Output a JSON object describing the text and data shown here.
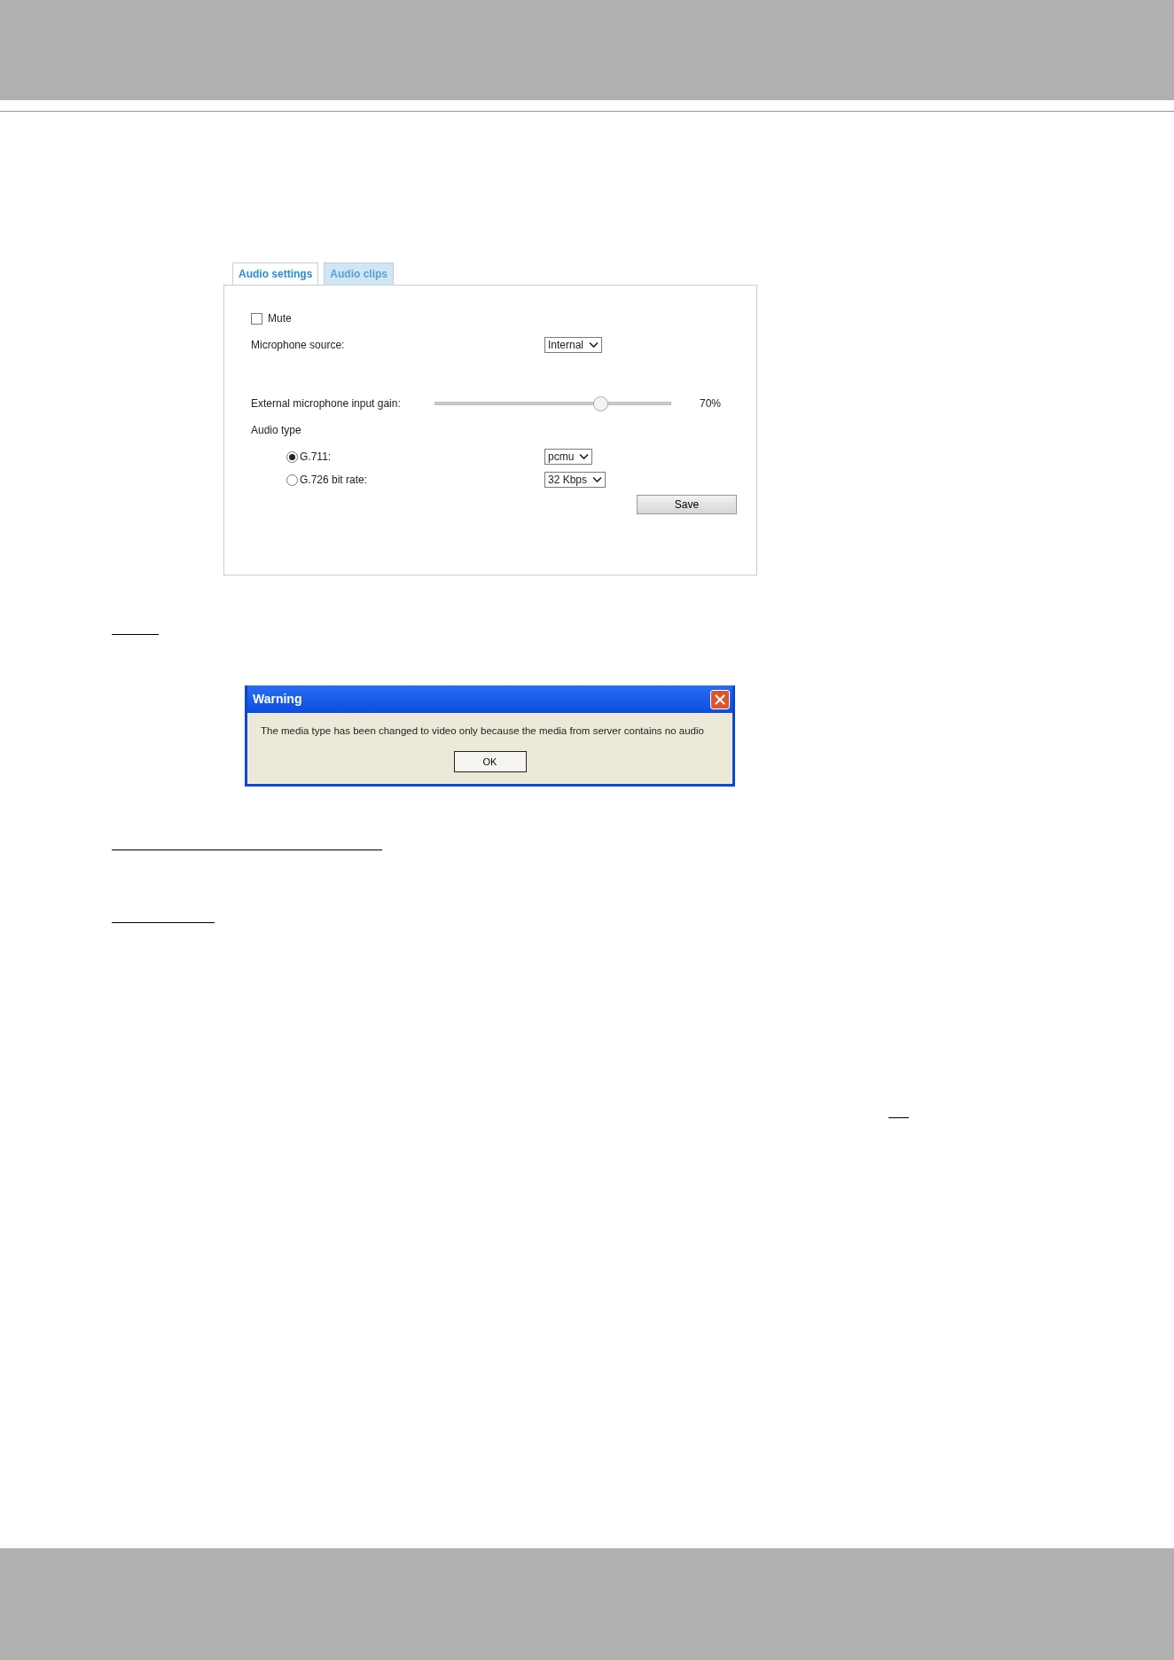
{
  "tabs": [
    {
      "label": "Audio settings",
      "selected": true
    },
    {
      "label": "Audio clips",
      "selected": false
    }
  ],
  "mute": {
    "label": "Mute",
    "checked": false
  },
  "microphone_source": {
    "label": "Microphone source:",
    "value": "Internal"
  },
  "gain": {
    "label": "External microphone input gain:",
    "level": 0.7,
    "reading": "70%"
  },
  "audio_type": {
    "label": "Audio type",
    "options": [
      {
        "label": "G.711:",
        "selected": true,
        "value": "pcmu"
      },
      {
        "label": "G.726 bit rate:",
        "selected": false,
        "value": "32 Kbps"
      }
    ]
  },
  "save_button": "Save",
  "warning_dialog": {
    "title": "Warning",
    "message": "The media type has been changed to video only because the media from server contains no audio",
    "button": "OK"
  }
}
